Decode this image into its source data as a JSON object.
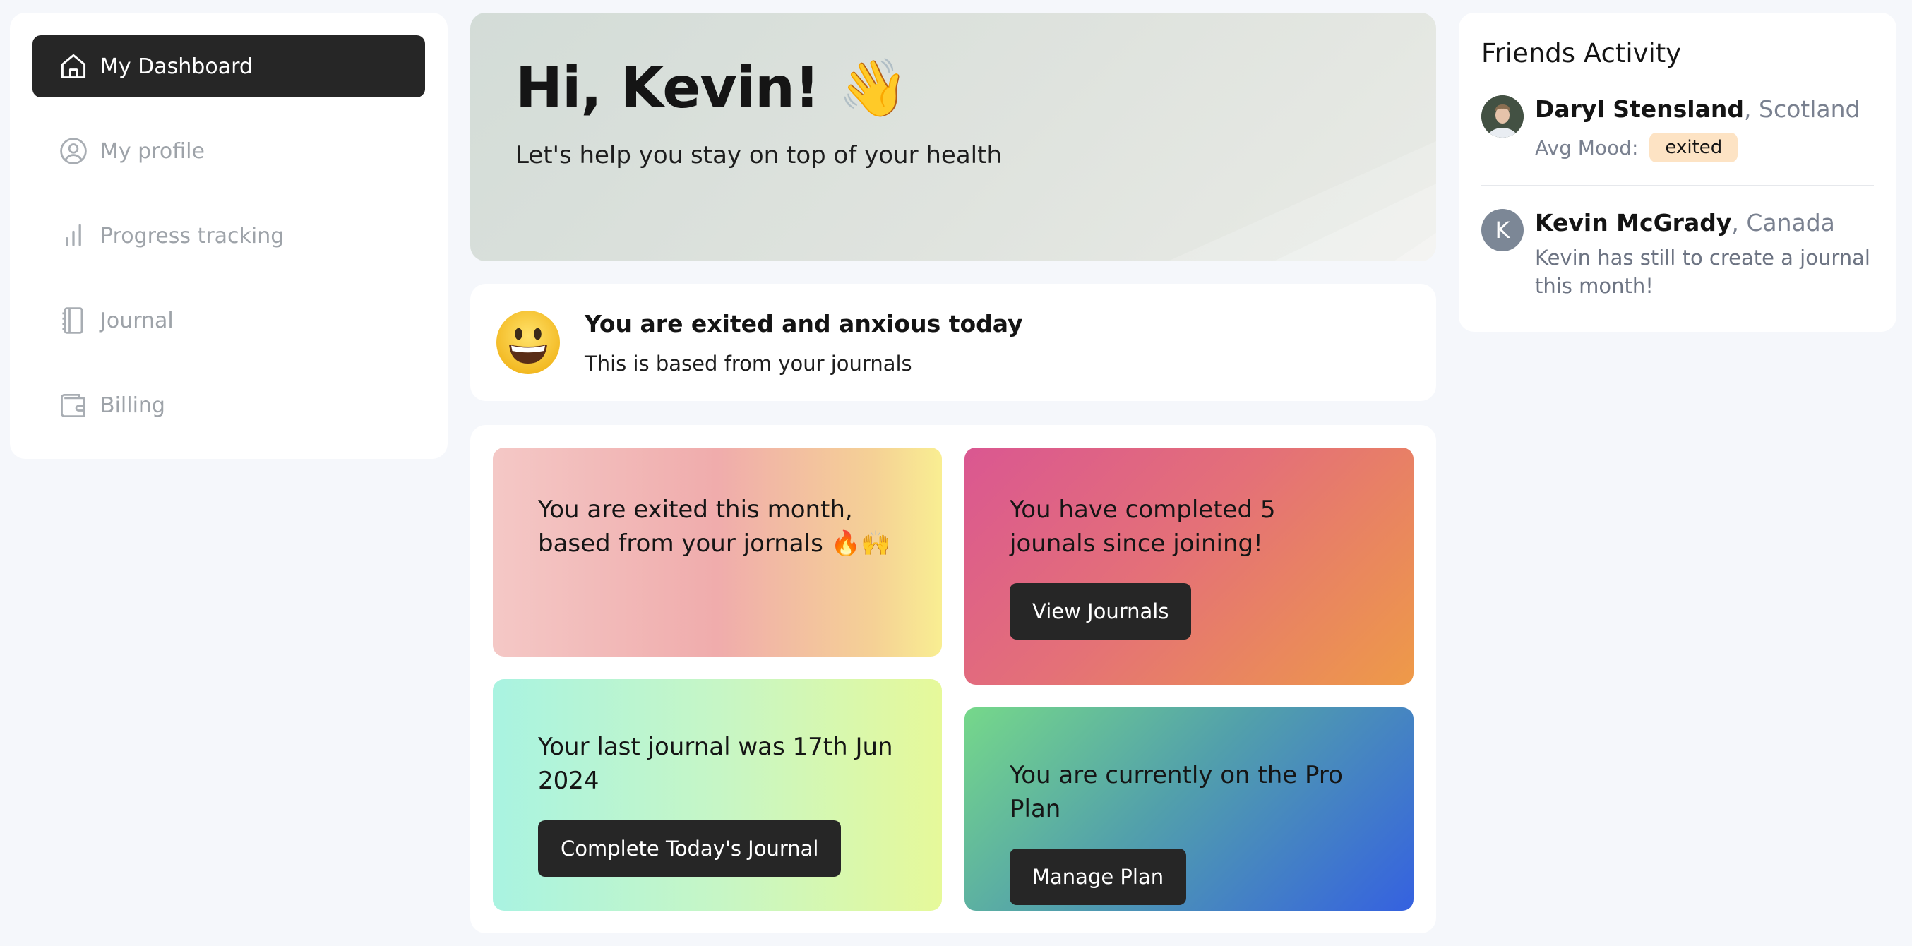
{
  "sidebar": {
    "items": [
      {
        "label": "My Dashboard",
        "icon": "home-icon",
        "active": true
      },
      {
        "label": "My profile",
        "icon": "user-circle-icon",
        "active": false
      },
      {
        "label": "Progress tracking",
        "icon": "bar-chart-icon",
        "active": false
      },
      {
        "label": "Journal",
        "icon": "notebook-icon",
        "active": false
      },
      {
        "label": "Billing",
        "icon": "wallet-icon",
        "active": false
      }
    ]
  },
  "greeting": {
    "title": "Hi, Kevin! 👋",
    "subtitle": "Let's help you stay on top of your health"
  },
  "mood": {
    "emoji": "grinning-face-icon",
    "title": "You are exited and anxious today",
    "subtitle": "This is based from your journals"
  },
  "cards": {
    "monthly_mood": {
      "text": "You are exited this month, based from your jornals 🔥🙌"
    },
    "journals_completed": {
      "text": "You have completed 5 jounals since joining!",
      "button": "View Journals"
    },
    "last_journal": {
      "text": "Your last journal was 17th Jun 2024",
      "button": "Complete Today's Journal"
    },
    "plan": {
      "text": "You are currently on the Pro Plan",
      "button": "Manage Plan"
    }
  },
  "friends": {
    "title": "Friends Activity",
    "items": [
      {
        "name": "Daryl Stensland",
        "location": ", Scotland",
        "mood_label": "Avg Mood:",
        "mood": "exited"
      },
      {
        "name": "Kevin McGrady",
        "location": ", Canada",
        "initial": "K",
        "note": "Kevin has still to create a journal this month!"
      }
    ]
  },
  "colors": {
    "active_nav": "#262626",
    "button": "#262626",
    "mood_badge": "#fde3c4",
    "muted_text": "#9ea3a9"
  }
}
